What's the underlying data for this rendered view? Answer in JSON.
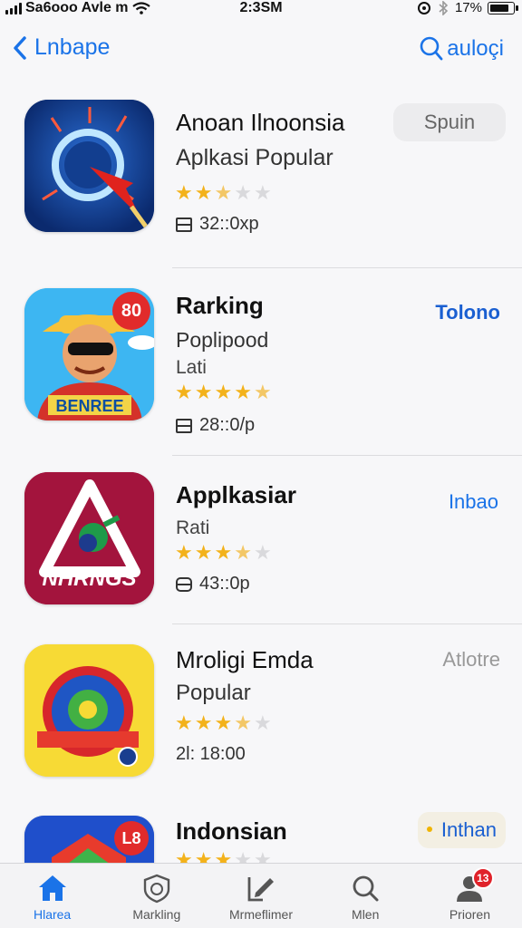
{
  "status_bar": {
    "carrier": "Sa6ooo Avle m",
    "time": "2:3SM",
    "battery_percent": "17%"
  },
  "nav": {
    "back_label": "Lnbape",
    "search_label": "auloçi"
  },
  "apps": [
    {
      "name": "Anoan Ilnoonsia",
      "subtitle": "Aplkasi Popular",
      "rating": 2.5,
      "meta": "32::0xp",
      "action": "Spuin"
    },
    {
      "name": "Rarking",
      "subtitle": "Poplipood",
      "subtitle2": "Lati",
      "rating": 4.5,
      "meta": "28::0/p",
      "action": "Tolono",
      "badge": "80",
      "icon_text": "BENREE"
    },
    {
      "name": "Applkasiar",
      "subtitle": "Rati",
      "rating": 3.5,
      "meta": "43::0p",
      "action": "Inbao",
      "icon_text": "NHRNGS"
    },
    {
      "name": "Mroligi Emda",
      "subtitle": "Popular",
      "rating": 3.5,
      "meta": "2l: 18:00",
      "action": "Atlotre"
    },
    {
      "name": "Indonsian",
      "rating": 3,
      "action": "Inthan",
      "badge": "L8"
    }
  ],
  "tab_bar": [
    {
      "label": "Hlarea",
      "icon": "home-icon",
      "active": true
    },
    {
      "label": "Markling",
      "icon": "shield-icon",
      "active": false
    },
    {
      "label": "Mrmeflimer",
      "icon": "edit-icon",
      "active": false
    },
    {
      "label": "Mlen",
      "icon": "search-icon",
      "active": false
    },
    {
      "label": "Prioren",
      "icon": "person-icon",
      "active": false,
      "badge": "13"
    }
  ],
  "colors": {
    "accent": "#1a73e8",
    "star": "#f3b21b",
    "badge": "#e0222a"
  }
}
